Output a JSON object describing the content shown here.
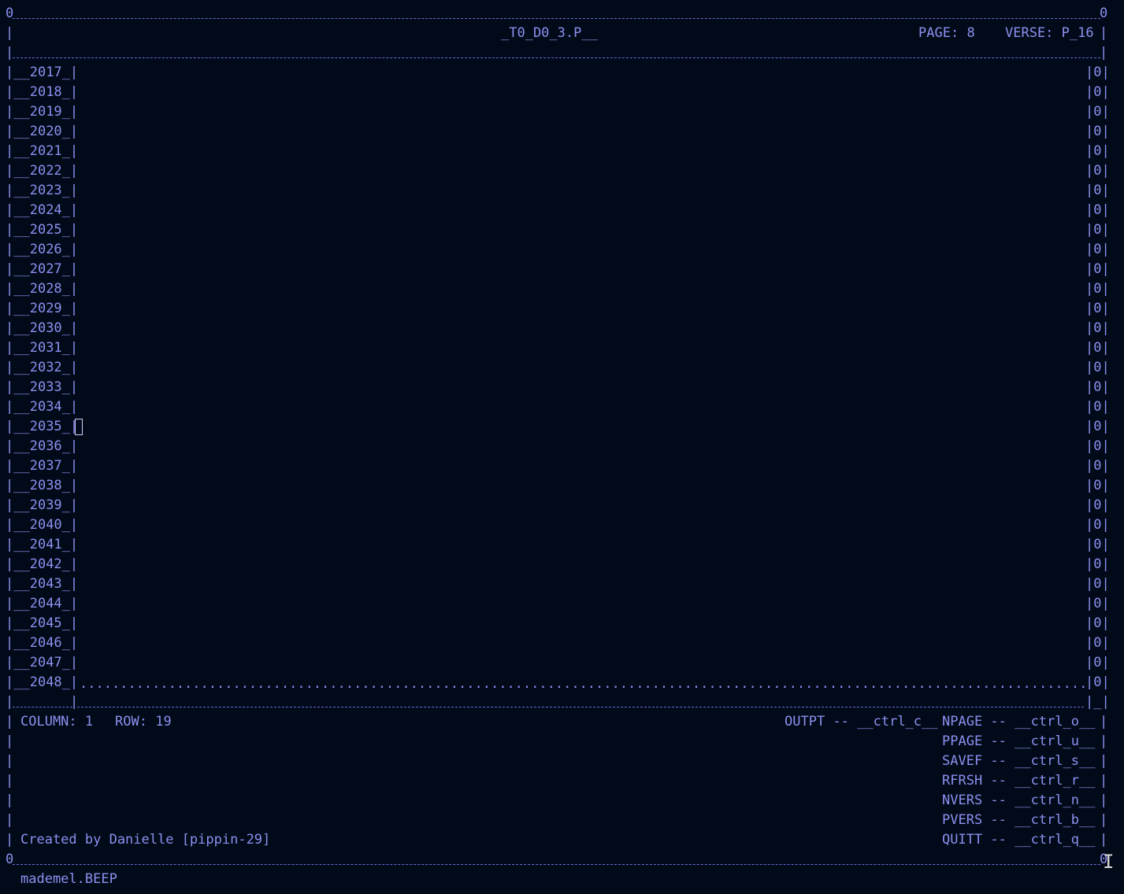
{
  "header": {
    "corner_left": "0",
    "corner_right": "0",
    "title": "_T0_D0_3.P__",
    "page_label": "PAGE:",
    "page_value": "8",
    "verse_label": "VERSE:",
    "verse_value": "P_16"
  },
  "rows": [
    {
      "label": "2017",
      "value": "0"
    },
    {
      "label": "2018",
      "value": "0"
    },
    {
      "label": "2019",
      "value": "0"
    },
    {
      "label": "2020",
      "value": "0"
    },
    {
      "label": "2021",
      "value": "0"
    },
    {
      "label": "2022",
      "value": "0"
    },
    {
      "label": "2023",
      "value": "0"
    },
    {
      "label": "2024",
      "value": "0"
    },
    {
      "label": "2025",
      "value": "0"
    },
    {
      "label": "2026",
      "value": "0"
    },
    {
      "label": "2027",
      "value": "0"
    },
    {
      "label": "2028",
      "value": "0"
    },
    {
      "label": "2029",
      "value": "0"
    },
    {
      "label": "2030",
      "value": "0"
    },
    {
      "label": "2031",
      "value": "0"
    },
    {
      "label": "2032",
      "value": "0"
    },
    {
      "label": "2033",
      "value": "0"
    },
    {
      "label": "2034",
      "value": "0"
    },
    {
      "label": "2035",
      "value": "0"
    },
    {
      "label": "2036",
      "value": "0"
    },
    {
      "label": "2037",
      "value": "0"
    },
    {
      "label": "2038",
      "value": "0"
    },
    {
      "label": "2039",
      "value": "0"
    },
    {
      "label": "2040",
      "value": "0"
    },
    {
      "label": "2041",
      "value": "0"
    },
    {
      "label": "2042",
      "value": "0"
    },
    {
      "label": "2043",
      "value": "0"
    },
    {
      "label": "2044",
      "value": "0"
    },
    {
      "label": "2045",
      "value": "0"
    },
    {
      "label": "2046",
      "value": "0"
    },
    {
      "label": "2047",
      "value": "0"
    },
    {
      "label": "2048",
      "value": "0"
    }
  ],
  "status": {
    "column_label": "COLUMN:",
    "column_value": "1",
    "row_label": "ROW:",
    "row_value": "19",
    "credit": "Created by Danielle [pippin-29]"
  },
  "shortcuts": [
    {
      "name": "OUTPT",
      "key": "__ctrl_c__"
    },
    {
      "name": "NPAGE",
      "key": "__ctrl_o__"
    },
    {
      "name": "PPAGE",
      "key": "__ctrl_u__"
    },
    {
      "name": "SAVEF",
      "key": "__ctrl_s__"
    },
    {
      "name": "RFRSH",
      "key": "__ctrl_r__"
    },
    {
      "name": "NVERS",
      "key": "__ctrl_n__"
    },
    {
      "name": "PVERS",
      "key": "__ctrl_b__"
    },
    {
      "name": "QUITT",
      "key": "__ctrl_q__"
    }
  ],
  "footer": {
    "corner_left": "0",
    "corner_right": "0",
    "message": "mademel.BEEP"
  },
  "colors": {
    "background": "#010a18",
    "text": "#8e8ff0",
    "cursor": "#cfd0ff"
  }
}
